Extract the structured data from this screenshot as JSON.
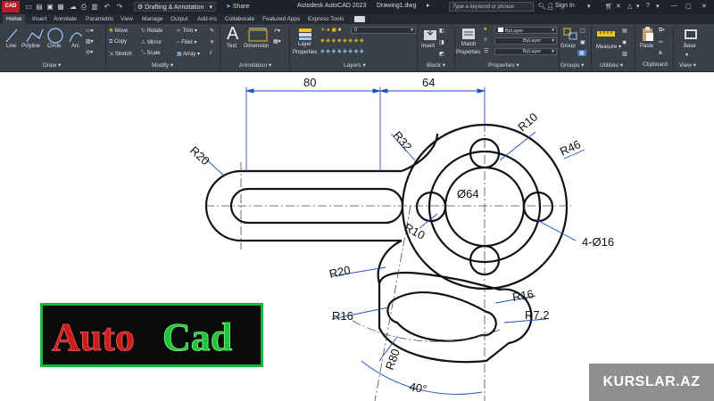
{
  "titlebar": {
    "app_badge": "CAD",
    "workspace": "Drafting & Annotation",
    "share": "Share",
    "app_title": "Autodesk AutoCAD 2023",
    "file_name": "Drawing1.dwg",
    "search_placeholder": "Type a keyword or phrase",
    "sign_in": "Sign In"
  },
  "tabs": [
    "Home",
    "Insert",
    "Annotate",
    "Parametric",
    "View",
    "Manage",
    "Output",
    "Add-ins",
    "Collaborate",
    "Featured Apps",
    "Express Tools"
  ],
  "ribbon": {
    "draw": {
      "title": "Draw",
      "line": "Line",
      "polyline": "Polyline",
      "circle": "Circle",
      "arc": "Arc"
    },
    "modify": {
      "title": "Modify",
      "move": "Move",
      "rotate": "Rotate",
      "trim": "Trim",
      "copy": "Copy",
      "mirror": "Mirror",
      "fillet": "Fillet",
      "stretch": "Stretch",
      "scale": "Scale",
      "array": "Array"
    },
    "annotation": {
      "title": "Annotation",
      "text": "Text",
      "dimension": "Dimension"
    },
    "layers": {
      "title": "Layers",
      "layer_properties": "Layer Properties",
      "current_layer": "0"
    },
    "block": {
      "title": "Block",
      "insert": "Insert"
    },
    "properties": {
      "title": "Properties",
      "match": "Match Properties",
      "color": "ByLayer",
      "linetype": "ByLayer",
      "lineweight": "ByLayer"
    },
    "groups": {
      "title": "Groups",
      "group": "Group"
    },
    "utilities": {
      "title": "Utilities",
      "measure": "Measure"
    },
    "clipboard": {
      "title": "Clipboard",
      "paste": "Paste"
    },
    "view": {
      "title": "View",
      "base": "Base"
    }
  },
  "drawing": {
    "dims": {
      "d80": "80",
      "d64": "64",
      "r32": "R32",
      "r10_top": "R10",
      "r46": "R46",
      "r20_left": "R20",
      "dia64": "Ø64",
      "r10_mid": "R10",
      "four_dia16": "4-Ø16",
      "r20_lower": "R20",
      "r16_right": "R16",
      "r16_left": "R16",
      "r7_2": "R7.2",
      "r80": "R80",
      "ang40": "40°"
    }
  },
  "logo": {
    "text_red": "Auto",
    "text_green": "Cad"
  },
  "watermark": "KURSLAR.AZ",
  "colors": {
    "ribbon": "#3a4048",
    "titlebar": "#1f2329",
    "accent_red": "#c81e1e",
    "accent_green": "#22c23a",
    "dim_blue": "#1e4fbf"
  }
}
